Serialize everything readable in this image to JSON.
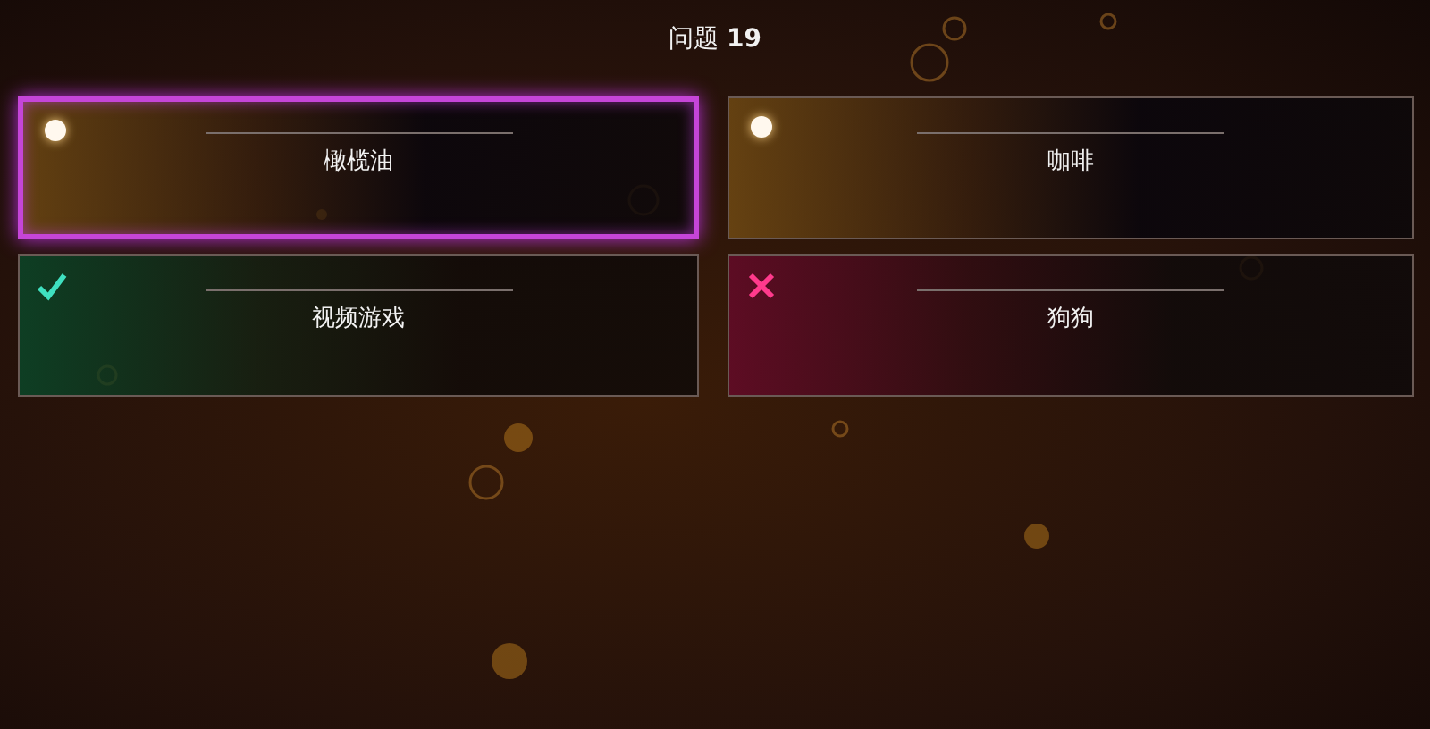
{
  "question": {
    "title": "问题 **19**"
  },
  "answers": [
    {
      "label": "橄榄油",
      "kind": "pending",
      "selected": true
    },
    {
      "label": "咖啡",
      "kind": "pending",
      "selected": false
    },
    {
      "label": "视频游戏",
      "kind": "correct",
      "selected": false
    },
    {
      "label": "狗狗",
      "kind": "wrong",
      "selected": false
    }
  ]
}
